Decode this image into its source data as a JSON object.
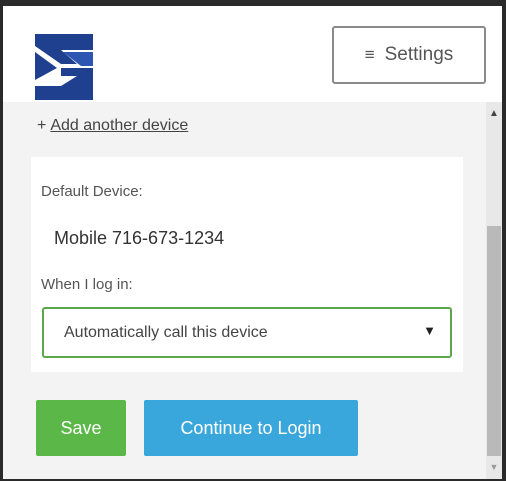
{
  "header": {
    "logo_icon": "company-logo-icon",
    "settings": {
      "icon": "hamburger-icon",
      "glyph": "≡",
      "label": "Settings"
    }
  },
  "devices": {
    "add_prefix": "+",
    "add_label": "Add another device"
  },
  "card": {
    "default_label": "Default Device:",
    "default_value": "Mobile 716-673-1234",
    "login_label": "When I log in:",
    "login_select_value": "Automatically call this device",
    "select_arrow_glyph": "▼"
  },
  "actions": {
    "save_label": "Save",
    "continue_label": "Continue to Login"
  },
  "colors": {
    "save": "#5bb848",
    "continue": "#3aa7dc",
    "logo": "#1f3f8f",
    "select_border": "#5aa84a"
  }
}
